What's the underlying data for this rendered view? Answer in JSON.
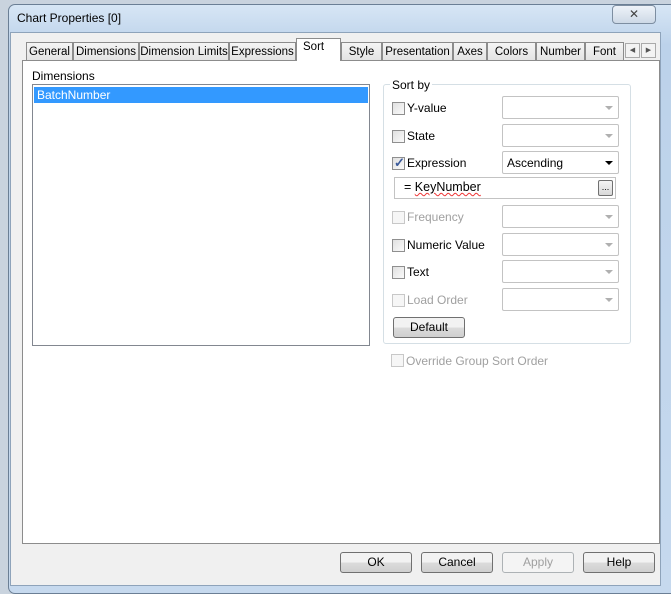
{
  "window": {
    "title": "Chart Properties [0]",
    "close_icon": "close-x-icon"
  },
  "tabs": [
    "General",
    "Dimensions",
    "Dimension Limits",
    "Expressions",
    "Sort",
    "Style",
    "Presentation",
    "Axes",
    "Colors",
    "Number",
    "Font"
  ],
  "active_tab": "Sort",
  "dimensions": {
    "label": "Dimensions",
    "items": [
      "BatchNumber"
    ],
    "selected": "BatchNumber"
  },
  "sort_by": {
    "label": "Sort by",
    "options": [
      {
        "label": "Y-value",
        "checked": false,
        "enabled": true,
        "value": ""
      },
      {
        "label": "State",
        "checked": false,
        "enabled": true,
        "value": ""
      },
      {
        "label": "Expression",
        "checked": true,
        "enabled": true,
        "value": "Ascending"
      },
      {
        "label": "Frequency",
        "checked": false,
        "enabled": false,
        "value": ""
      },
      {
        "label": "Numeric Value",
        "checked": false,
        "enabled": true,
        "value": ""
      },
      {
        "label": "Text",
        "checked": false,
        "enabled": true,
        "value": ""
      },
      {
        "label": "Load Order",
        "checked": false,
        "enabled": false,
        "value": ""
      }
    ],
    "expression_prefix": "= ",
    "expression": "KeyNumber",
    "ellipsis": "...",
    "default_label": "Default"
  },
  "override_group_sort": {
    "label": "Override Group Sort Order",
    "checked": false,
    "enabled": false
  },
  "footer": {
    "ok": "OK",
    "cancel": "Cancel",
    "apply": "Apply",
    "help": "Help"
  },
  "colors": {
    "selection": "#3399ff"
  }
}
